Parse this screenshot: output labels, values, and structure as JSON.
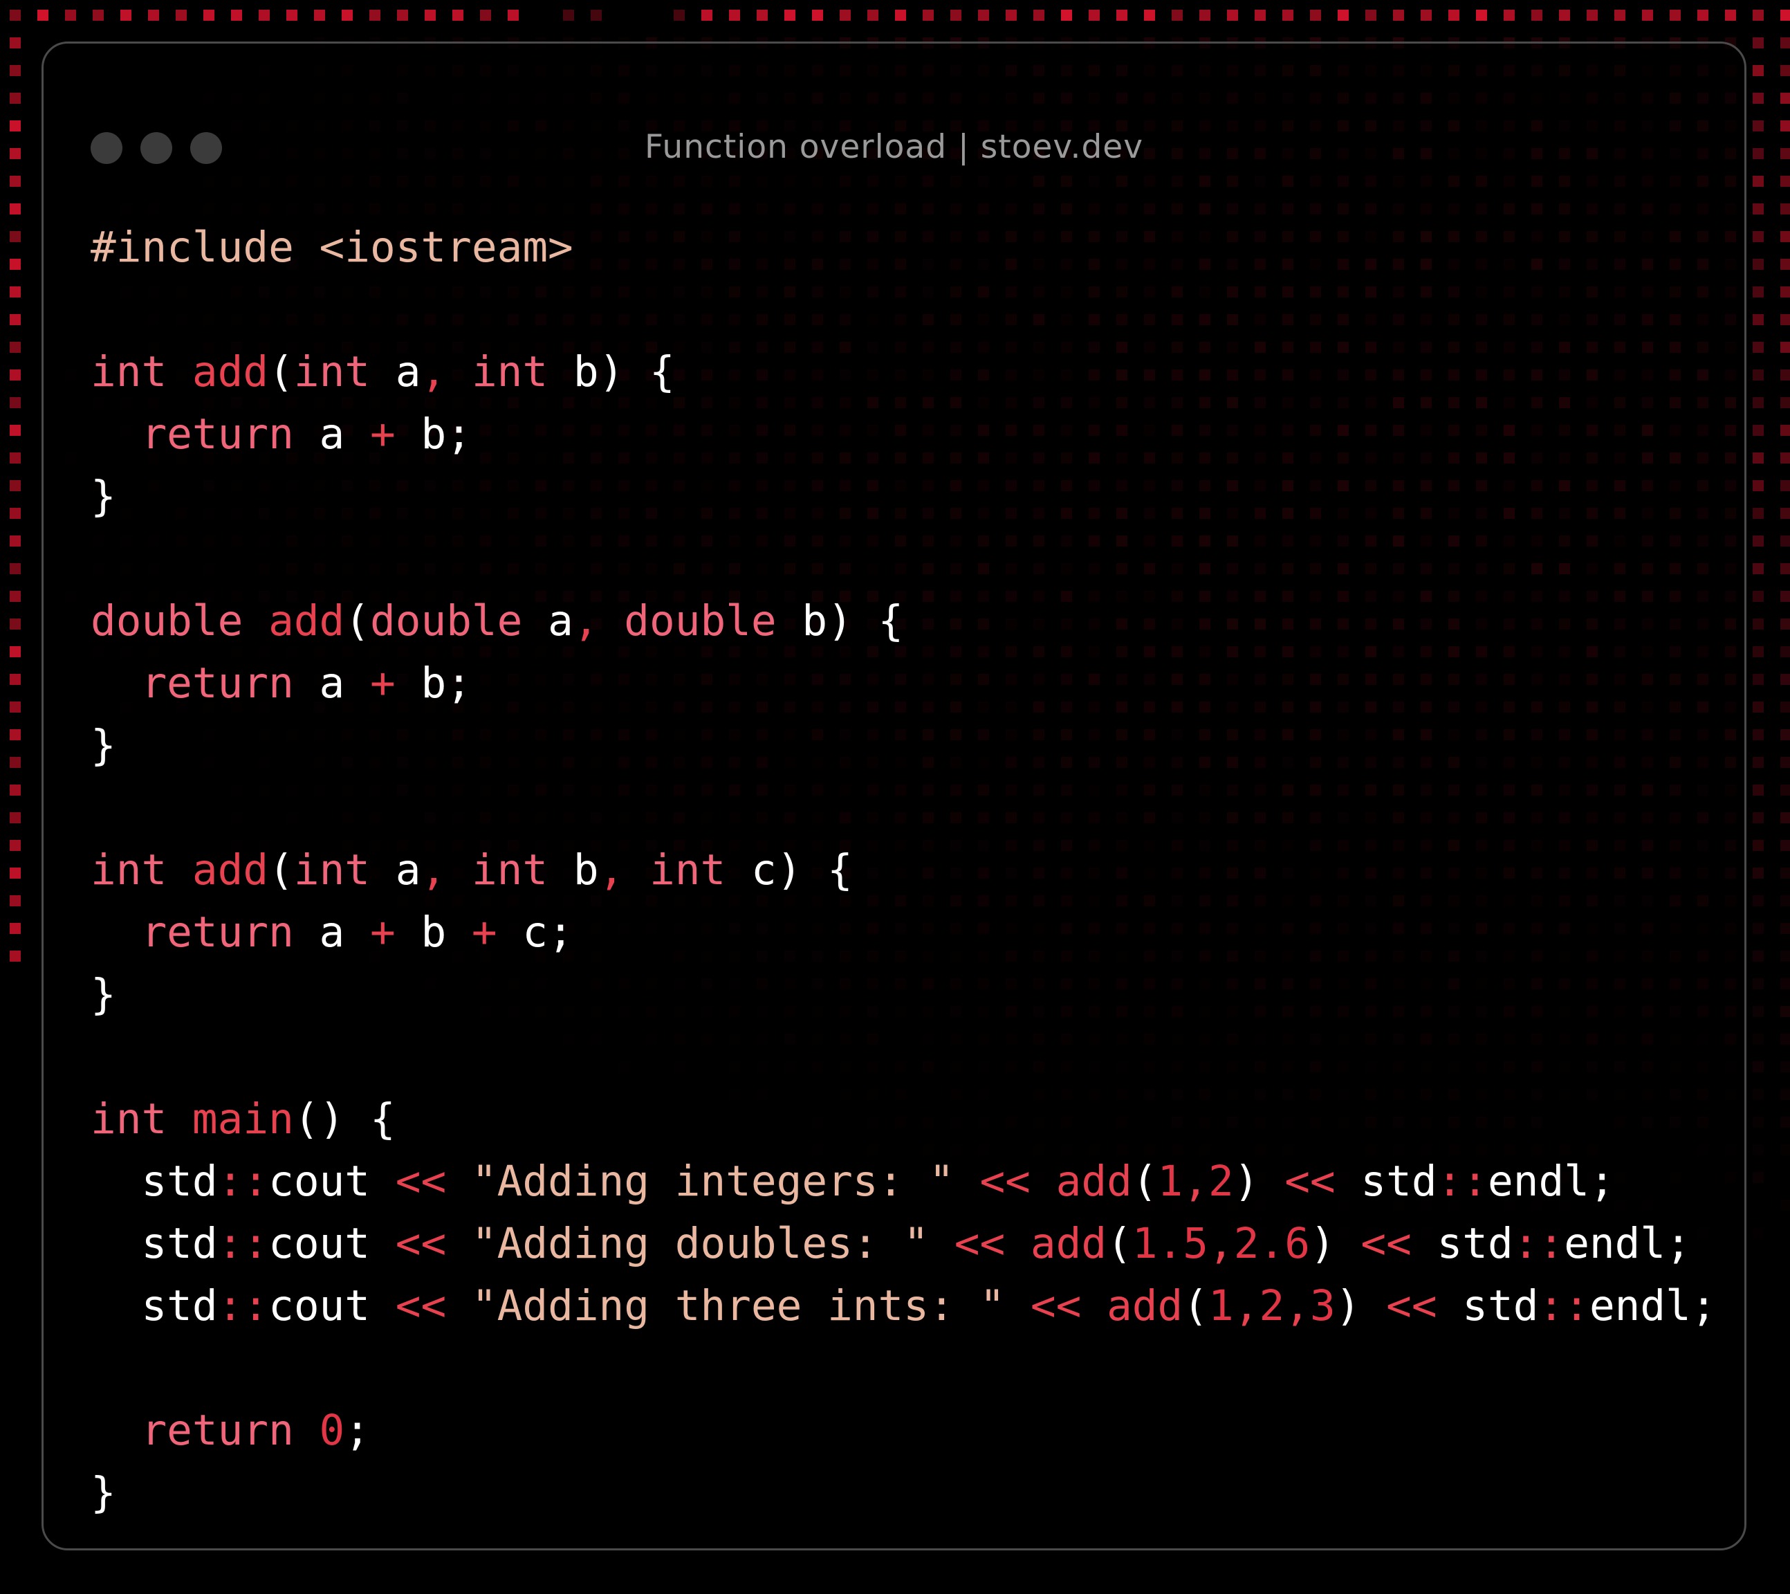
{
  "window": {
    "title": "Function overload | stoev.dev"
  },
  "colors": {
    "background": "#000000",
    "dot_accent": "#e3142f",
    "window_border": "#4a4a4a",
    "traffic_light": "#3b3b3b",
    "title_text": "#9a9a9a",
    "keyword": "#f1657a",
    "function_name": "#e8414f",
    "operator": "#e8414f",
    "string": "#eab8a1",
    "preprocessor": "#eab8a1",
    "number": "#e23646",
    "identifier": "#ffffff"
  },
  "code": {
    "language": "cpp",
    "lines": [
      [
        [
          "pp",
          "#include <iostream>"
        ]
      ],
      [],
      [
        [
          "kw",
          "int"
        ],
        [
          "id",
          " "
        ],
        [
          "fn",
          "add"
        ],
        [
          "id",
          "("
        ],
        [
          "kw",
          "int"
        ],
        [
          "id",
          " a"
        ],
        [
          "op",
          ","
        ],
        [
          "id",
          " "
        ],
        [
          "kw",
          "int"
        ],
        [
          "id",
          " b) {"
        ]
      ],
      [
        [
          "id",
          "  "
        ],
        [
          "kw",
          "return"
        ],
        [
          "id",
          " a "
        ],
        [
          "op",
          "+"
        ],
        [
          "id",
          " b;"
        ]
      ],
      [
        [
          "id",
          "}"
        ]
      ],
      [],
      [
        [
          "kw",
          "double"
        ],
        [
          "id",
          " "
        ],
        [
          "fn",
          "add"
        ],
        [
          "id",
          "("
        ],
        [
          "kw",
          "double"
        ],
        [
          "id",
          " a"
        ],
        [
          "op",
          ","
        ],
        [
          "id",
          " "
        ],
        [
          "kw",
          "double"
        ],
        [
          "id",
          " b) {"
        ]
      ],
      [
        [
          "id",
          "  "
        ],
        [
          "kw",
          "return"
        ],
        [
          "id",
          " a "
        ],
        [
          "op",
          "+"
        ],
        [
          "id",
          " b;"
        ]
      ],
      [
        [
          "id",
          "}"
        ]
      ],
      [],
      [
        [
          "kw",
          "int"
        ],
        [
          "id",
          " "
        ],
        [
          "fn",
          "add"
        ],
        [
          "id",
          "("
        ],
        [
          "kw",
          "int"
        ],
        [
          "id",
          " a"
        ],
        [
          "op",
          ","
        ],
        [
          "id",
          " "
        ],
        [
          "kw",
          "int"
        ],
        [
          "id",
          " b"
        ],
        [
          "op",
          ","
        ],
        [
          "id",
          " "
        ],
        [
          "kw",
          "int"
        ],
        [
          "id",
          " c) {"
        ]
      ],
      [
        [
          "id",
          "  "
        ],
        [
          "kw",
          "return"
        ],
        [
          "id",
          " a "
        ],
        [
          "op",
          "+"
        ],
        [
          "id",
          " b "
        ],
        [
          "op",
          "+"
        ],
        [
          "id",
          " c;"
        ]
      ],
      [
        [
          "id",
          "}"
        ]
      ],
      [],
      [
        [
          "kw",
          "int"
        ],
        [
          "id",
          " "
        ],
        [
          "fn",
          "main"
        ],
        [
          "id",
          "() {"
        ]
      ],
      [
        [
          "id",
          "  std"
        ],
        [
          "op",
          "::"
        ],
        [
          "id",
          "cout "
        ],
        [
          "op",
          "<<"
        ],
        [
          "id",
          " "
        ],
        [
          "str",
          "\"Adding integers: \""
        ],
        [
          "id",
          " "
        ],
        [
          "op",
          "<<"
        ],
        [
          "id",
          " "
        ],
        [
          "fn",
          "add"
        ],
        [
          "id",
          "("
        ],
        [
          "num",
          "1"
        ],
        [
          "op",
          ","
        ],
        [
          "num",
          "2"
        ],
        [
          "id",
          ") "
        ],
        [
          "op",
          "<<"
        ],
        [
          "id",
          " std"
        ],
        [
          "op",
          "::"
        ],
        [
          "id",
          "endl;"
        ]
      ],
      [
        [
          "id",
          "  std"
        ],
        [
          "op",
          "::"
        ],
        [
          "id",
          "cout "
        ],
        [
          "op",
          "<<"
        ],
        [
          "id",
          " "
        ],
        [
          "str",
          "\"Adding doubles: \""
        ],
        [
          "id",
          " "
        ],
        [
          "op",
          "<<"
        ],
        [
          "id",
          " "
        ],
        [
          "fn",
          "add"
        ],
        [
          "id",
          "("
        ],
        [
          "num",
          "1.5"
        ],
        [
          "op",
          ","
        ],
        [
          "num",
          "2.6"
        ],
        [
          "id",
          ") "
        ],
        [
          "op",
          "<<"
        ],
        [
          "id",
          " std"
        ],
        [
          "op",
          "::"
        ],
        [
          "id",
          "endl;"
        ]
      ],
      [
        [
          "id",
          "  std"
        ],
        [
          "op",
          "::"
        ],
        [
          "id",
          "cout "
        ],
        [
          "op",
          "<<"
        ],
        [
          "id",
          " "
        ],
        [
          "str",
          "\"Adding three ints: \""
        ],
        [
          "id",
          " "
        ],
        [
          "op",
          "<<"
        ],
        [
          "id",
          " "
        ],
        [
          "fn",
          "add"
        ],
        [
          "id",
          "("
        ],
        [
          "num",
          "1"
        ],
        [
          "op",
          ","
        ],
        [
          "num",
          "2"
        ],
        [
          "op",
          ","
        ],
        [
          "num",
          "3"
        ],
        [
          "id",
          ") "
        ],
        [
          "op",
          "<<"
        ],
        [
          "id",
          " std"
        ],
        [
          "op",
          "::"
        ],
        [
          "id",
          "endl;"
        ]
      ],
      [],
      [
        [
          "id",
          "  "
        ],
        [
          "kw",
          "return"
        ],
        [
          "id",
          " "
        ],
        [
          "num",
          "0"
        ],
        [
          "id",
          ";"
        ]
      ],
      [
        [
          "id",
          "}"
        ]
      ]
    ]
  }
}
